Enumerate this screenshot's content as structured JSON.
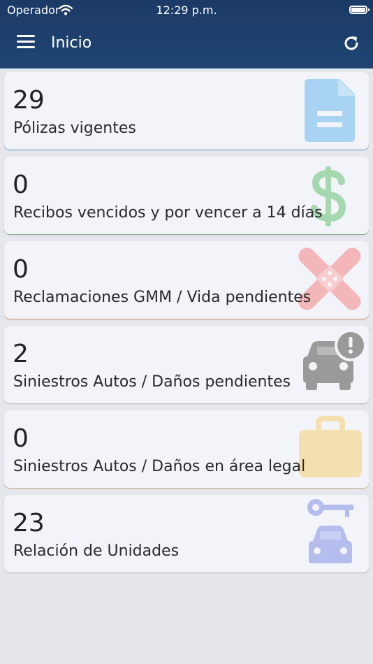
{
  "status_bar": {
    "carrier": "Operador",
    "time": "12:29 p.m."
  },
  "header": {
    "title": "Inicio",
    "menu_icon": "hamburger-menu-icon",
    "refresh_icon": "refresh-icon"
  },
  "colors": {
    "header_bg": "#1f4474",
    "card_bg": "#f3f4f9",
    "page_bg": "#e6e7ec"
  },
  "cards": [
    {
      "count": "29",
      "label": "Pólizas vigentes",
      "icon": "document-icon",
      "color": "#a9d3f3",
      "accent": "#7fb6e6"
    },
    {
      "count": "0",
      "label": "Recibos vencidos y por vencer a 14 días",
      "icon": "dollar-icon",
      "color": "#a6d8b0",
      "accent": "#9bc89f"
    },
    {
      "count": "0",
      "label": "Reclamaciones GMM / Vida pendientes",
      "icon": "bandage-icon",
      "color": "#f3b7b9",
      "accent": "#e8a88a"
    },
    {
      "count": "2",
      "label": "Siniestros Autos / Daños pendientes",
      "icon": "car-alert-icon",
      "color": "#9a9a9a",
      "accent": "#d6d6d6"
    },
    {
      "count": "0",
      "label": "Siniestros Autos / Daños en área legal",
      "icon": "briefcase-icon",
      "color": "#f3dfb0",
      "accent": "#e3c999"
    },
    {
      "count": "23",
      "label": "Relación de Unidades",
      "icon": "car-key-icon",
      "color": "#b5bcee",
      "accent": "#d6d6d6"
    }
  ]
}
